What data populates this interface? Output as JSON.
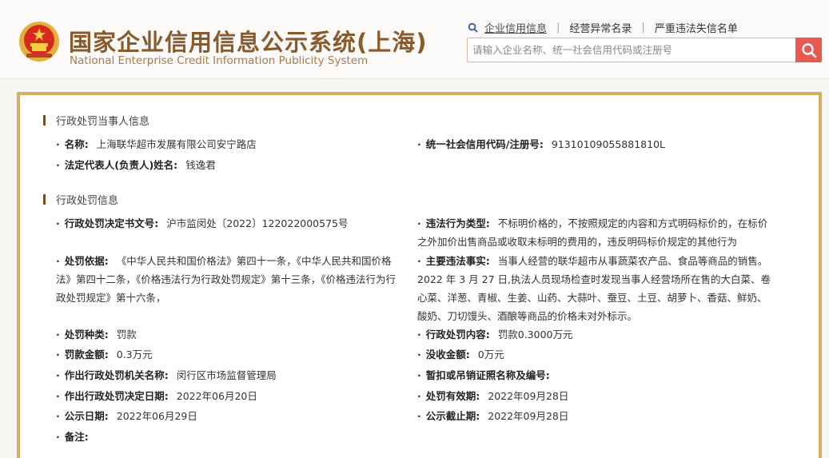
{
  "header": {
    "title_cn": "国家企业信用信息公示系统(上海)",
    "title_en": "National Enterprise Credit Information Publicity System",
    "emblem_icon": "national-emblem-icon"
  },
  "top_links": [
    {
      "label": "企业信用信息",
      "active": true
    },
    {
      "label": "经营异常名录",
      "active": false
    },
    {
      "label": "严重违法失信名单",
      "active": false
    }
  ],
  "search": {
    "placeholder": "请输入企业名称、统一社会信用代码或注册号",
    "value": ""
  },
  "colors": {
    "brand": "#8a5a2b",
    "accent": "#e85a50",
    "panel_border": "#d9ad64"
  },
  "party_section": {
    "title": "行政处罚当事人信息",
    "name_label": "名称:",
    "name_value": "上海联华超市发展有限公司安宁路店",
    "credit_code_label": "统一社会信用代码/注册号:",
    "credit_code_value": "91310109055881810L",
    "legal_rep_label": "法定代表人(负责人)姓名:",
    "legal_rep_value": "钱逸君"
  },
  "penalty_section": {
    "title": "行政处罚信息",
    "doc_no_label": "行政处罚决定书文号:",
    "doc_no_value": "沪市监闵处〔2022〕122022000575号",
    "violation_type_label": "违法行为类型:",
    "violation_type_value_line1": "不标明价格的，不按照规定的内容和方式明码标价的，在标价",
    "violation_type_value_line2": "之外加价出售商品或收取未标明的费用的，违反明码标价规定的其他行为",
    "basis_label": "处罚依据:",
    "basis_value_line1": "《中华人民共和国价格法》第四十一条，《中华人民共和国价格",
    "basis_value_line2": "法》第四十二条，《价格违法行为行政处罚规定》第十三条，《价格违法行为行",
    "basis_value_line3": "政处罚规定》第十六条，",
    "facts_label": "主要违法事实:",
    "facts_value_line1": "当事人经营的联华超市从事蔬菜农产品、食品等商品的销售。",
    "facts_value_line2": "2022 年 3 月 27 日,执法人员现场检查时发现当事人经营场所在售的大白菜、卷",
    "facts_value_line3": "心菜、洋葱、青椒、生姜、山药、大蒜叶、蚕豆、土豆、胡萝卜、香菇、鲜奶、",
    "facts_value_line4": "酸奶、刀切馒头、酒酿等商品的价格未对外标示。",
    "kind_label": "处罚种类:",
    "kind_value": "罚款",
    "content_label": "行政处罚内容:",
    "content_value": "罚款0.3000万元",
    "fine_label": "罚款金额:",
    "fine_value": "0.3万元",
    "confiscation_label": "没收金额:",
    "confiscation_value": "0万元",
    "authority_label": "作出行政处罚机关名称:",
    "authority_value": "闵行区市场监督管理局",
    "license_label": "暂扣或吊销证照名称及编号:",
    "license_value": "",
    "decision_date_label": "作出行政处罚决定日期:",
    "decision_date_value": "2022年06月20日",
    "valid_label": "处罚有效期:",
    "valid_value": "2022年09月28日",
    "publish_date_label": "公示日期:",
    "publish_date_value": "2022年06月29日",
    "publish_end_label": "公示截止期:",
    "publish_end_value": "2022年09月28日",
    "remark_label": "备注:",
    "remark_value": ""
  }
}
